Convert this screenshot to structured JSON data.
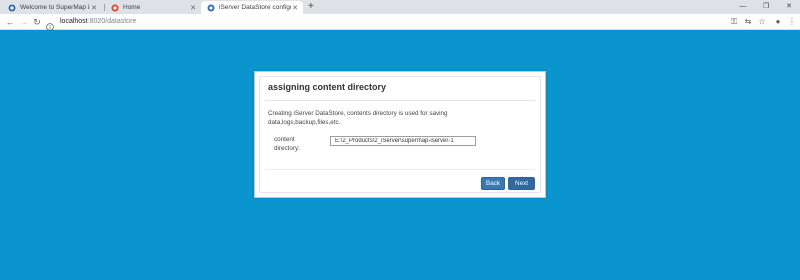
{
  "browser": {
    "tabs": [
      {
        "title": "Welcome to SuperMap iServer",
        "icon": "supermap-icon",
        "active": false
      },
      {
        "title": "Home",
        "icon": "gitlab-icon",
        "active": false
      },
      {
        "title": "iServer DataStore configuratio",
        "icon": "supermap-icon",
        "active": true
      }
    ],
    "new_tab": "+",
    "window_controls": {
      "minimize": "—",
      "restore": "❐",
      "close": "✕"
    },
    "nav": {
      "back": "←",
      "forward": "→",
      "reload": "↻"
    },
    "address": {
      "host": "localhost",
      "rest": ":8020/datastore"
    },
    "toolbar_icons": {
      "key": "⚿",
      "translate": "⇆",
      "star": "☆",
      "account": "●",
      "menu": "⋮"
    }
  },
  "dialog": {
    "title": "assigning content directory",
    "description": "Creating iServer DataStore, contents directory is used for saving data,logs,backup,files,etc.",
    "field_label": "content directory:",
    "field_value": "E:\\2_Products\\2_iServer\\supermap-iserver-1",
    "back_label": "Back",
    "next_label": "Next"
  },
  "colors": {
    "background": "#0b95cf",
    "button": "#3a78b4"
  }
}
